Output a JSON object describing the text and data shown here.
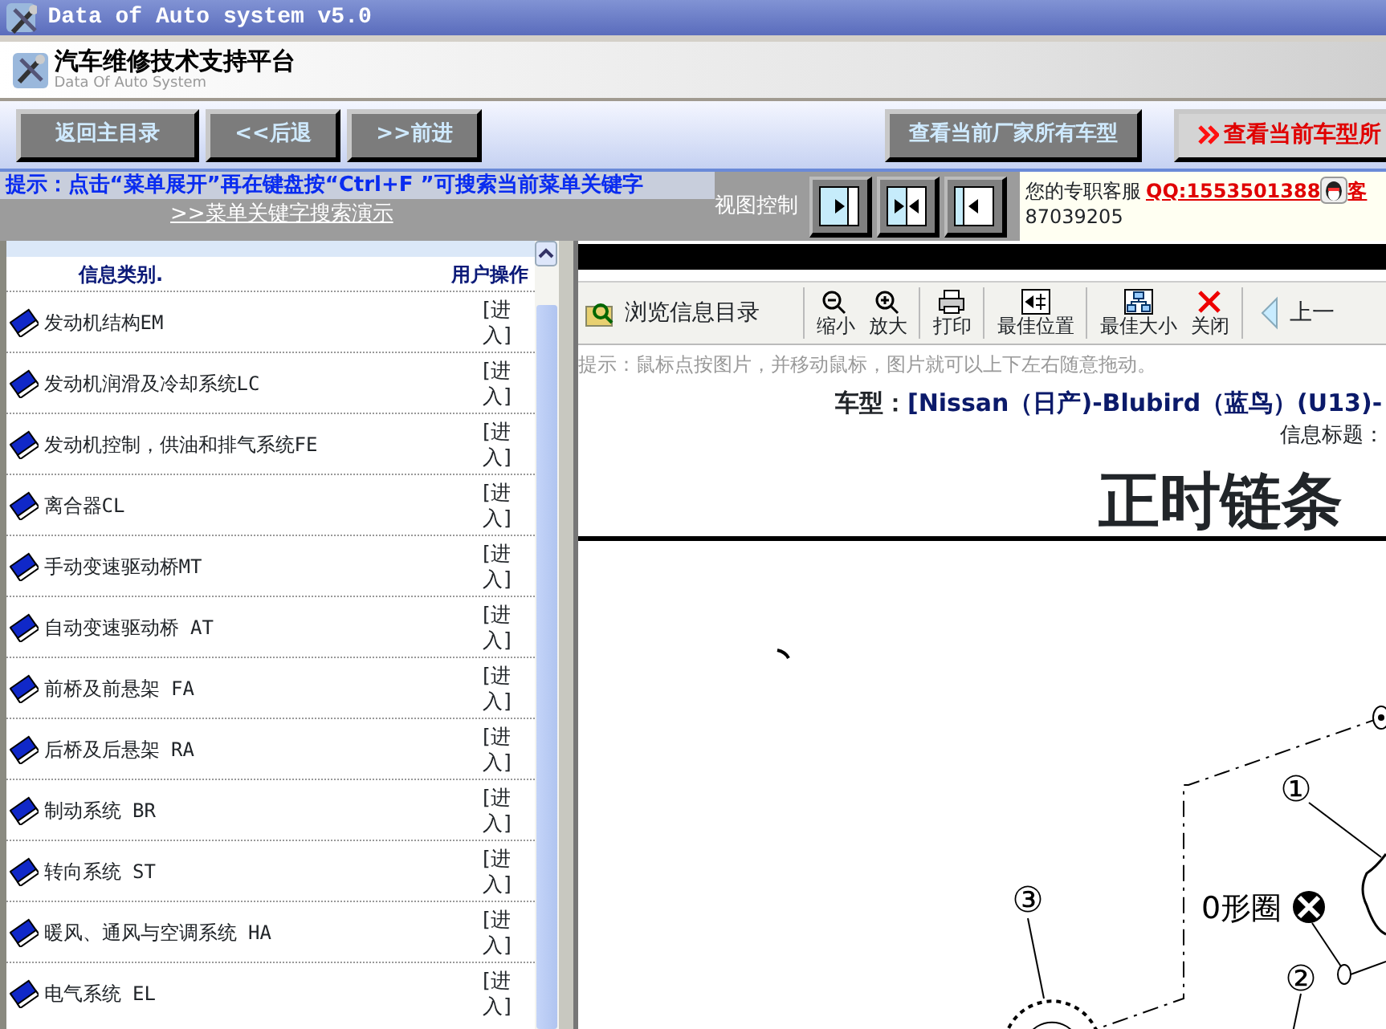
{
  "window": {
    "title": "Data of Auto system v5.0"
  },
  "header": {
    "title": "汽车维修技术支持平台",
    "subtitle": "Data Of Auto System"
  },
  "nav_buttons": [
    {
      "label": "返回主目录"
    },
    {
      "label": "<<后退"
    },
    {
      "label": ">>前进"
    }
  ],
  "model_buttons": [
    {
      "label": "查看当前厂家所有车型",
      "kind": "plain"
    },
    {
      "label": "查看当前车型所",
      "kind": "chevron"
    }
  ],
  "tip": {
    "text": "提示：点击“菜单展开”再在键盘按“Ctrl+F ”可搜索当前菜单关键字",
    "link": ">>菜单关键字搜索演示"
  },
  "view_control": {
    "label": "视图控制",
    "buttons": [
      {
        "kind": "right"
      },
      {
        "kind": "center"
      },
      {
        "kind": "left"
      }
    ]
  },
  "support": {
    "label": "您的专职客服",
    "qq": "QQ:1553501388",
    "extra": "客",
    "phone": "87039205"
  },
  "category_table": {
    "columns": [
      "信息类别.",
      "用户操作"
    ],
    "rows": [
      {
        "name": "发动机结构EM",
        "action": "[进入]"
      },
      {
        "name": "发动机润滑及冷却系统LC",
        "action": "[进入]"
      },
      {
        "name": "发动机控制，供油和排气系统FE",
        "action": "[进入]"
      },
      {
        "name": "离合器CL",
        "action": "[进入]"
      },
      {
        "name": "手动变速驱动桥MT",
        "action": "[进入]"
      },
      {
        "name": "自动变速驱动桥 AT",
        "action": "[进入]"
      },
      {
        "name": "前桥及前悬架 FA",
        "action": "[进入]"
      },
      {
        "name": "后桥及后悬架 RA",
        "action": "[进入]"
      },
      {
        "name": "制动系统 BR",
        "action": "[进入]"
      },
      {
        "name": "转向系统 ST",
        "action": "[进入]"
      },
      {
        "name": "暖风、通风与空调系统 HA",
        "action": "[进入]"
      },
      {
        "name": "电气系统 EL",
        "action": "[进入]"
      }
    ]
  },
  "viewer": {
    "toolbar": [
      {
        "label": "浏览信息目录",
        "kind": "catalog"
      },
      {
        "label": "缩小",
        "kind": "zoom-out"
      },
      {
        "label": "放大",
        "kind": "zoom-in"
      },
      {
        "label": "打印",
        "kind": "print"
      },
      {
        "label": "最佳位置",
        "kind": "fit-position"
      },
      {
        "label": "最佳大小",
        "kind": "fit-size"
      },
      {
        "label": "关闭",
        "kind": "close"
      },
      {
        "label": "上一",
        "kind": "prev"
      }
    ],
    "hint": "提示：鼠标点按图片，并移动鼠标，图片就可以上下左右随意拖动。",
    "document": {
      "model_label": "车型：",
      "model": "[Nissan（日产)-Blubird（蓝鸟）(U13)-",
      "info_label": "信息标题：",
      "title": "正时链条",
      "callouts": [
        "①",
        "②",
        "③"
      ],
      "seal_label": "0形圈"
    }
  }
}
